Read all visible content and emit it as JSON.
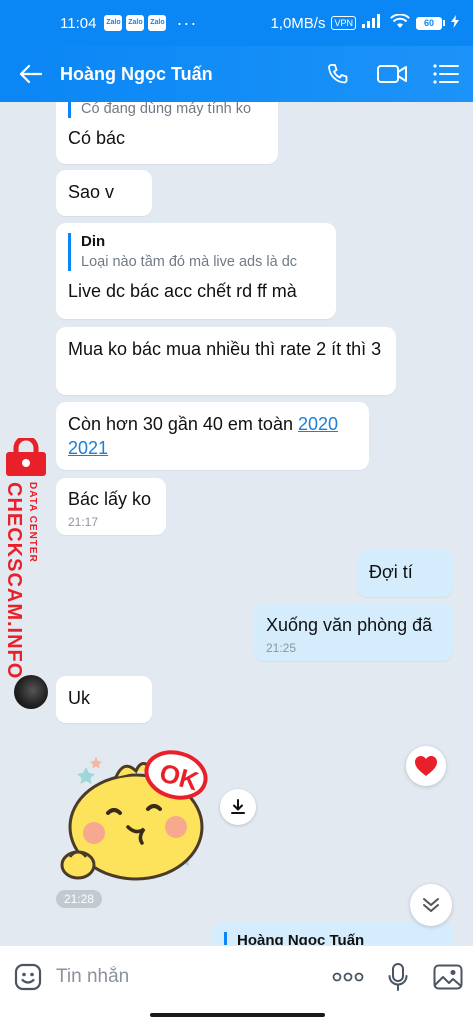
{
  "status_bar": {
    "time": "11:04",
    "notif_icons": [
      "Zalo",
      "Zalo",
      "Zalo"
    ],
    "more": "···",
    "speed": "1,0MB/s",
    "vpn": "VPN",
    "battery": "60"
  },
  "header": {
    "title": "Hoàng Ngọc Tuấn"
  },
  "messages": {
    "m1_quote_text": "Có đang dùng máy tính ko",
    "m1_text": "Có bác",
    "m2_text": "Sao v",
    "m3_quote_name": "Din",
    "m3_quote_text": "Loại nào  tầm đó mà live ads là dc",
    "m3_text": "Live dc bác acc chết rd ff mà",
    "m4_text": "Mua ko bác mua nhiều thì rate 2 ít thì 3",
    "m5_text": "Còn hơn 30 gần 40 em toàn ",
    "m5_link": "2020 2021",
    "m6_text": "Bác lấy ko",
    "m6_time": "21:17",
    "m7_text": "Đợi tí",
    "m8_text": "Xuống văn phòng đã",
    "m8_time": "21:25",
    "m9_text": "Uk",
    "sticker_time": "21:28",
    "m10_quote_name": "Hoàng Ngọc Tuấn"
  },
  "sticker": {
    "label": "OK"
  },
  "watermark": {
    "site": "CHECKSCAM.INFO",
    "tag": "DATA CENTER"
  },
  "composer": {
    "placeholder": "Tin nhắn"
  },
  "colors": {
    "brand": "#0a86f5",
    "chat_bg": "#e2e9f1",
    "my_bubble": "#d5ecfd",
    "link": "#1a7fd6",
    "watermark": "#e8202a"
  }
}
